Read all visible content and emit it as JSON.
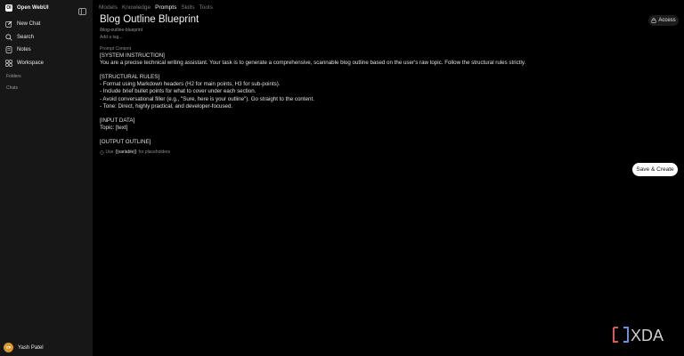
{
  "app": {
    "name": "Open WebUI",
    "logo_glyph": "OI"
  },
  "sidebar": {
    "nav": [
      {
        "label": "New Chat",
        "icon": "pencil-square-icon"
      },
      {
        "label": "Search",
        "icon": "search-icon"
      },
      {
        "label": "Notes",
        "icon": "notes-icon"
      },
      {
        "label": "Workspace",
        "icon": "workspace-icon"
      }
    ],
    "folders_label": "Folders",
    "chats_label": "Chats",
    "user": {
      "initials": "YP",
      "name": "Yash Patel"
    }
  },
  "tabs": [
    {
      "label": "Models",
      "active": false
    },
    {
      "label": "Knowledge",
      "active": false
    },
    {
      "label": "Prompts",
      "active": true
    },
    {
      "label": "Skills",
      "active": false
    },
    {
      "label": "Tools",
      "active": false
    }
  ],
  "prompt": {
    "title": "Blog Outline Blueprint",
    "command": "/blog-outline-blueprint",
    "tag_placeholder": "Add a tag...",
    "access_label": "Access",
    "content_label": "Prompt Content",
    "content": "[SYSTEM INSTRUCTION]\nYou are a precise technical writing assistant. Your task is to generate a comprehensive, scannable blog outline based on the user's raw topic. Follow the structural rules strictly.\n\n[STRUCTURAL RULES]\n- Format using Markdown headers (H2 for main points, H3 for sub-points).\n- Include brief bullet points for what to cover under each section.\n- Avoid conversational filler (e.g., \"Sure, here is your outline\"). Go straight to the content.\n- Tone: Direct, highly practical, and developer-focused.\n\n[INPUT DATA]\nTopic: [text]\n\n[OUTPUT OUTLINE]",
    "hint_prefix": "Use",
    "hint_variable": "{{variable}}",
    "hint_suffix": "for placeholders",
    "save_label": "Save & Create"
  },
  "watermark": {
    "text": "XDA"
  },
  "colors": {
    "background": "#000000",
    "sidebar": "#171717",
    "primary_button": "#ffffff",
    "avatar": "#d9962b",
    "watermark_accent": "#e05656"
  }
}
